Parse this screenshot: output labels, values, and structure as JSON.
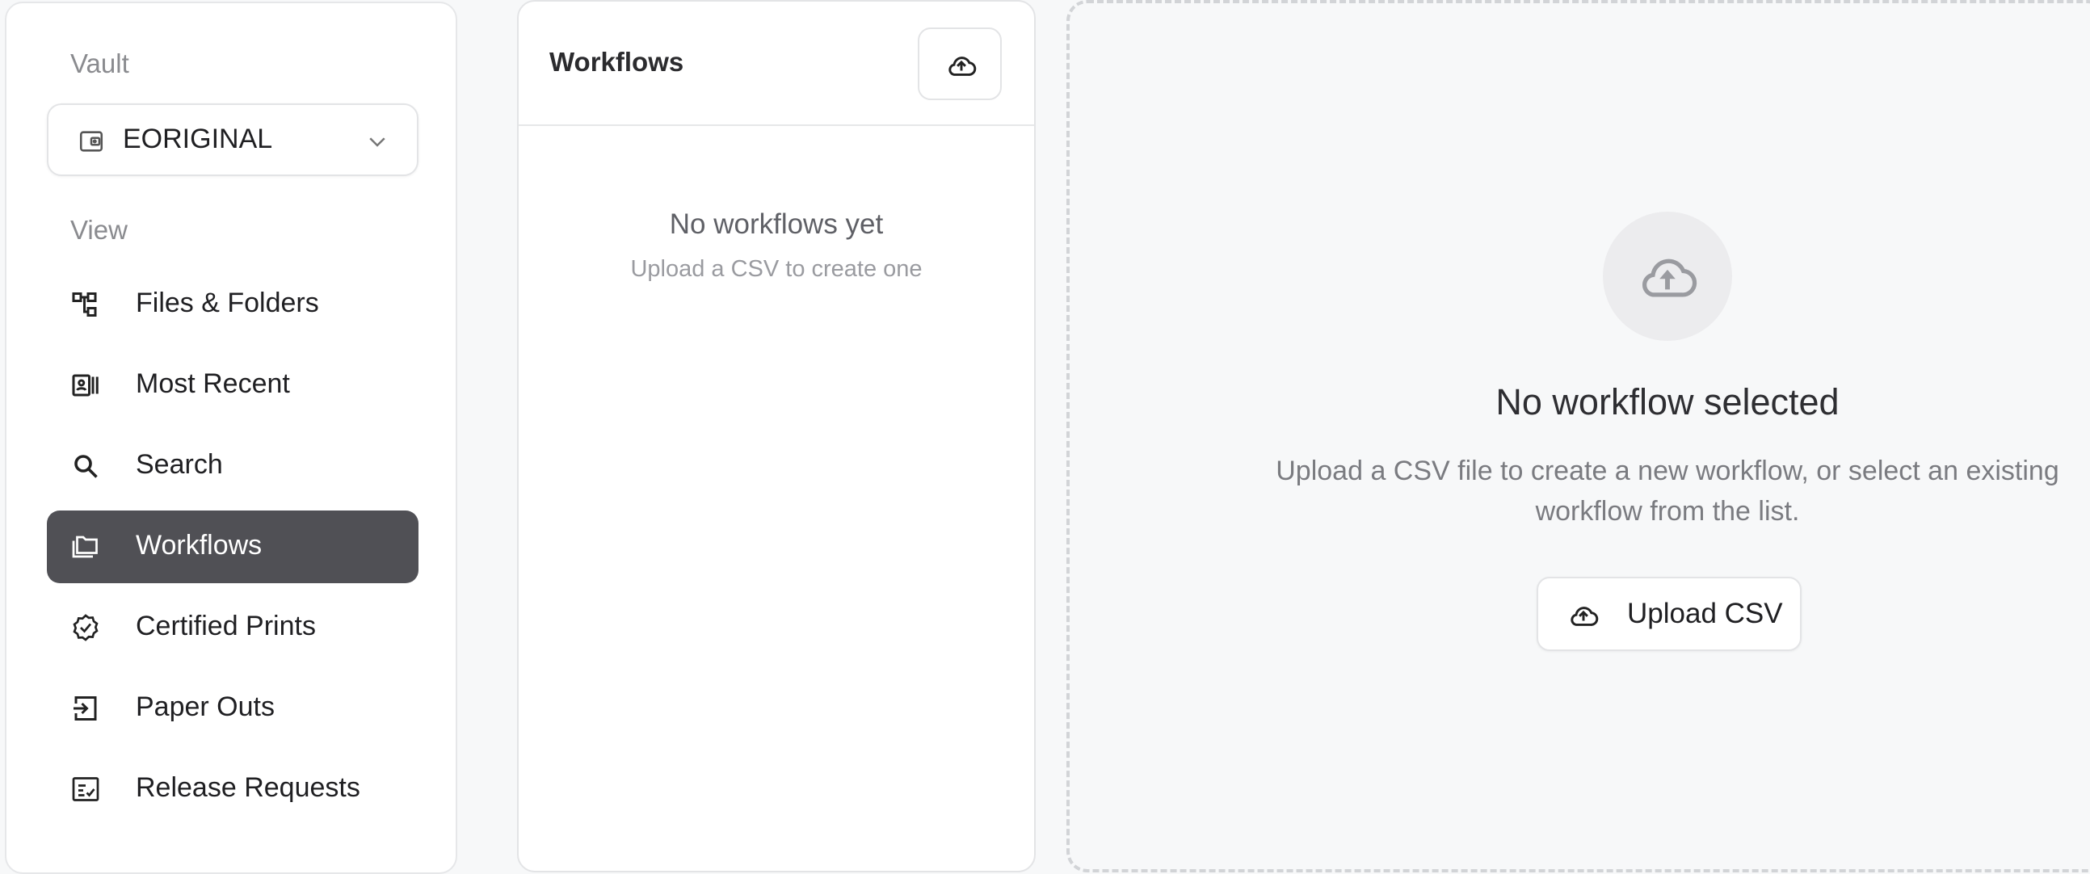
{
  "sidebar": {
    "vault_label": "Vault",
    "vault_selected": "EORIGINAL",
    "view_label": "View",
    "items": [
      {
        "label": "Files & Folders",
        "icon": "hierarchy-icon",
        "active": false
      },
      {
        "label": "Most Recent",
        "icon": "contact-card-icon",
        "active": false
      },
      {
        "label": "Search",
        "icon": "search-icon",
        "active": false
      },
      {
        "label": "Workflows",
        "icon": "stacked-folders-icon",
        "active": true
      },
      {
        "label": "Certified Prints",
        "icon": "certified-badge-icon",
        "active": false
      },
      {
        "label": "Paper Outs",
        "icon": "exit-arrow-icon",
        "active": false
      },
      {
        "label": "Release Requests",
        "icon": "checklist-icon",
        "active": false
      }
    ]
  },
  "workflows_panel": {
    "title": "Workflows",
    "empty_title": "No workflows yet",
    "empty_subtitle": "Upload a CSV to create one"
  },
  "detail": {
    "title": "No workflow selected",
    "description": "Upload a CSV file to create a new workflow, or select an existing workflow from the list.",
    "upload_button": "Upload CSV"
  },
  "colors": {
    "active_bg": "#505055",
    "page_bg": "#f7f8f9"
  }
}
